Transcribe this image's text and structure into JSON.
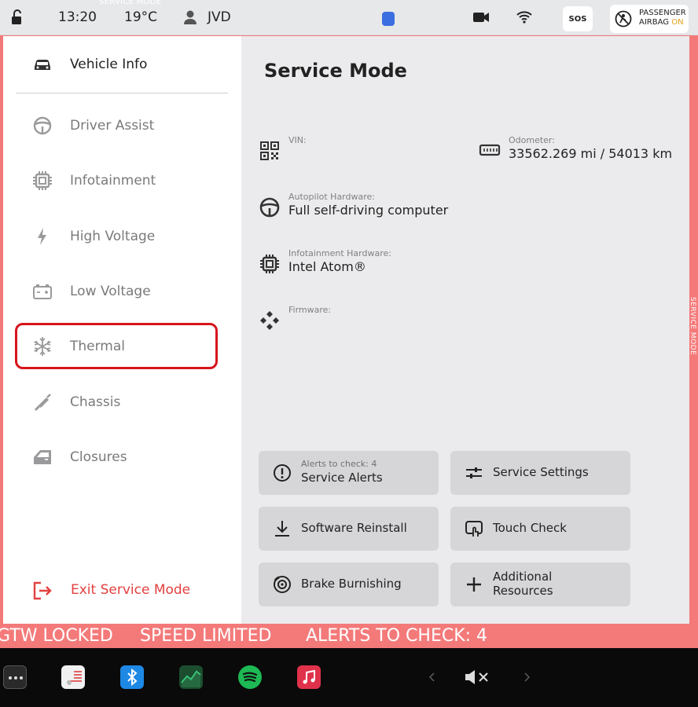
{
  "status_bar": {
    "time": "13:20",
    "temperature": "19°C",
    "user": "JVD",
    "mode_label": "SERVICE MODE",
    "sos": "SOS",
    "airbag_line1": "PASSENGER",
    "airbag_line2": "AIRBAG",
    "airbag_status": "ON",
    "airbag_status_color": "#e8a21c"
  },
  "sidebar": {
    "items": [
      {
        "label": "Vehicle Info",
        "icon": "car-icon"
      },
      {
        "label": "Driver Assist",
        "icon": "steering-wheel-icon"
      },
      {
        "label": "Infotainment",
        "icon": "chip-icon"
      },
      {
        "label": "High Voltage",
        "icon": "lightning-icon"
      },
      {
        "label": "Low Voltage",
        "icon": "battery-icon"
      },
      {
        "label": "Thermal",
        "icon": "snowflake-icon"
      },
      {
        "label": "Chassis",
        "icon": "shock-absorber-icon"
      },
      {
        "label": "Closures",
        "icon": "door-icon"
      }
    ],
    "exit_label": "Exit Service Mode",
    "exit_color": "#e3403f"
  },
  "content": {
    "title": "Service Mode",
    "vin_label": "VIN:",
    "odometer_label": "Odometer:",
    "odometer_value": "33562.269 mi / 54013 km",
    "autopilot_label": "Autopilot Hardware:",
    "autopilot_value": "Full self-driving computer",
    "infotainment_label": "Infotainment Hardware:",
    "infotainment_value": "Intel Atom®",
    "firmware_label": "Firmware:"
  },
  "buttons": {
    "alerts_sub": "Alerts to check: 4",
    "alerts": "Service Alerts",
    "settings": "Service Settings",
    "reinstall": "Software Reinstall",
    "touch": "Touch Check",
    "brake": "Brake Burnishing",
    "resources_line1": "Additional",
    "resources_line2": "Resources"
  },
  "banner": {
    "items": [
      "GTW LOCKED",
      "SPEED LIMITED",
      "ALERTS TO CHECK: 4"
    ],
    "color": "#f47a7a"
  },
  "side_strip": "SERVICE MODE",
  "dock": {
    "apps": [
      "more-icon",
      "notes-icon",
      "bluetooth-icon",
      "stocks-icon",
      "spotify-icon",
      "music-icon"
    ],
    "mute_icon": "mute-icon"
  }
}
